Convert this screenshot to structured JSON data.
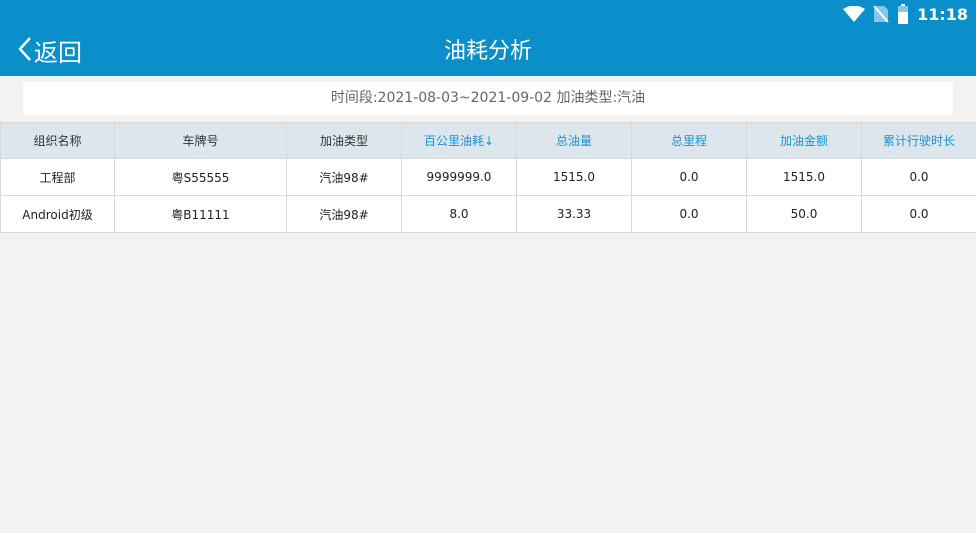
{
  "status_bar": {
    "time": "11:18",
    "icons": [
      "wifi-icon",
      "no-sim-icon",
      "battery-icon"
    ]
  },
  "header": {
    "back_label": "返回",
    "title": "油耗分析"
  },
  "filter": {
    "text": "时间段:2021-08-03~2021-09-02   加油类型:汽油"
  },
  "table": {
    "columns": [
      "组织名称",
      "车牌号",
      "加油类型",
      "百公里油耗↓",
      "总油量",
      "总里程",
      "加油金额",
      "累计行驶时长"
    ],
    "rows": [
      [
        "工程部",
        "粤S55555",
        "汽油98#",
        "9999999.0",
        "1515.0",
        "0.0",
        "1515.0",
        "0.0"
      ],
      [
        "Android初级",
        "粤B11111",
        "汽油98#",
        "8.0",
        "33.33",
        "0.0",
        "50.0",
        "0.0"
      ]
    ]
  },
  "colors": {
    "appbar": "#0a8fca",
    "header_row": "#dde6ec",
    "accent_text": "#1a92d2",
    "background": "#f2f2f2"
  }
}
